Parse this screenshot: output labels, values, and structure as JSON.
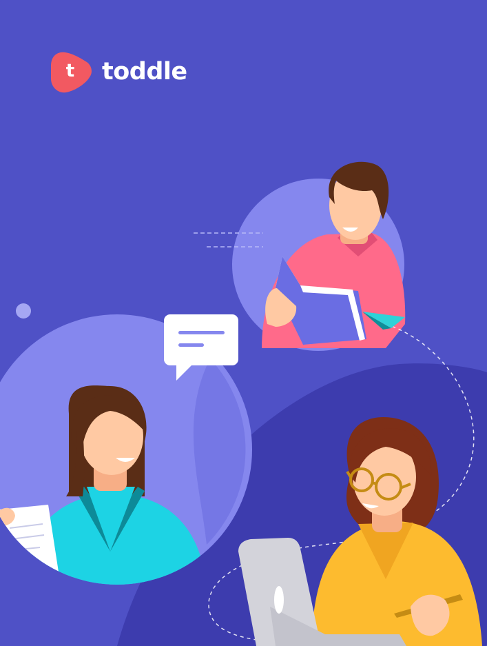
{
  "brand": {
    "name": "toddle",
    "mark_letter": "t",
    "mark_color": "#F25961",
    "text_color": "#FFFFFF"
  },
  "colors": {
    "background": "#4F51C6",
    "bubble_light": "#8587EE",
    "bubble_mid": "#6B6DE0",
    "wave_dark": "#3D3CAE",
    "teacher_sweater": "#FF6A8A",
    "student_shirt": "#1DD3E4",
    "student_collar": "#0D8A98",
    "parent_sweater": "#FDBB2F",
    "skin": "#FFC9A3",
    "hair_brown": "#5A2D16",
    "hair_auburn": "#7E2F17",
    "laptop": "#D3D3DA"
  },
  "illustration": {
    "speech_bubble_icon": "speech-bubble-icon",
    "paper_plane_icon": "paper-plane-icon"
  }
}
